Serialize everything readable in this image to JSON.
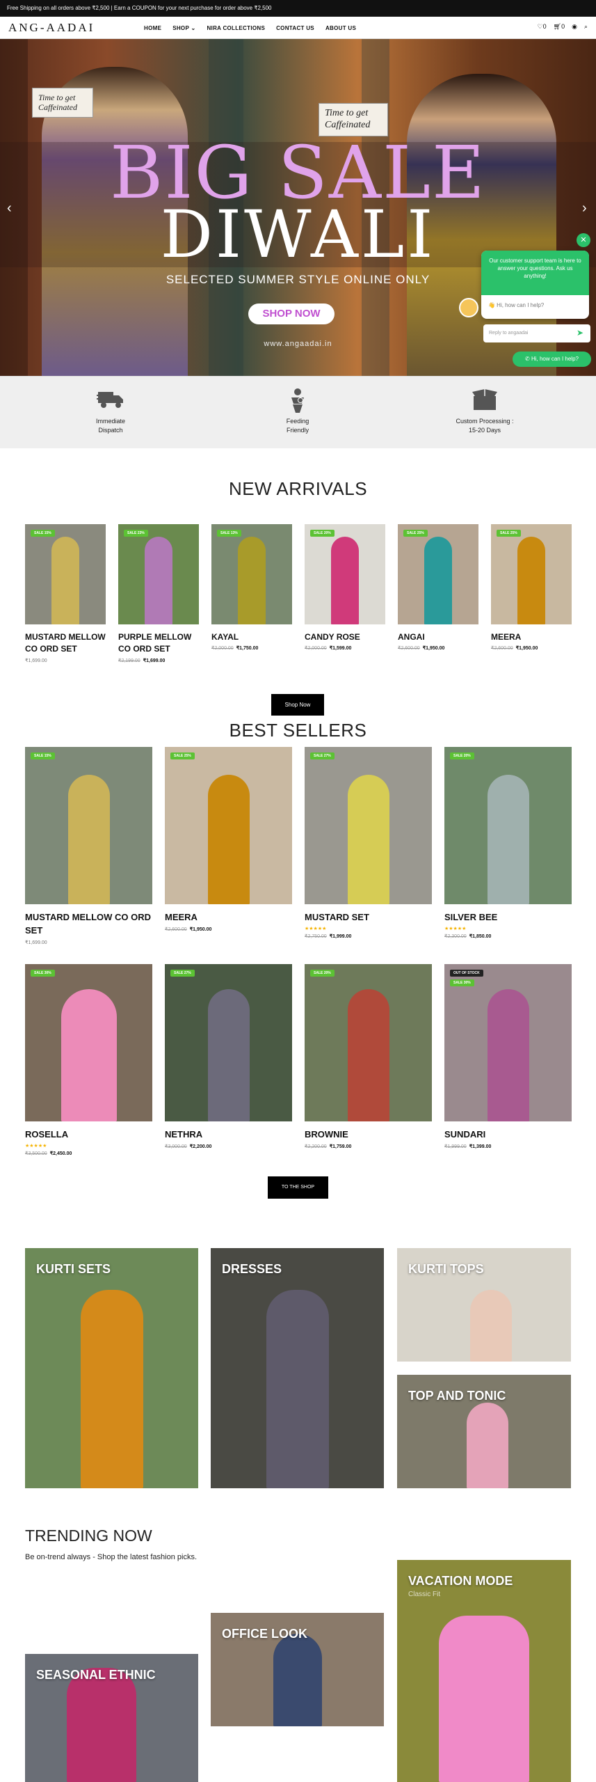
{
  "topbar": {
    "text": "Free Shipping on all orders above ₹2,500 | Earn a COUPON for your next purchase for order above ₹2,500"
  },
  "header": {
    "logo": "ANG-AADAI",
    "nav": [
      "HOME",
      "SHOP ⌄",
      "NIRA COLLECTIONS",
      "CONTACT US",
      "ABOUT US"
    ],
    "wishlist_count": "0",
    "cart_count": "0"
  },
  "hero": {
    "sign_left": "Time to get Caffeinated",
    "sign_right": "Time to get Caffeinated",
    "line1": "BIG SALE",
    "line2": "DIWALI",
    "subtitle": "SELECTED SUMMER STYLE ONLINE ONLY",
    "cta": "SHOP NOW",
    "site": "www.angaadai.in"
  },
  "chat": {
    "message": "Our customer support team is here to answer your questions. Ask us anything!",
    "quick": "👋 Hi, how can I help?",
    "placeholder": "Reply to angaadai",
    "button": "Hi, how can I help?"
  },
  "features": [
    {
      "line1": "Immediate",
      "line2": "Dispatch",
      "icon": "truck-icon"
    },
    {
      "line1": "Feeding",
      "line2": "Friendly",
      "icon": "mother-baby-icon"
    },
    {
      "line1": "Custom Processing :",
      "line2": "15-20 Days",
      "icon": "box-icon"
    }
  ],
  "new_arrivals": {
    "title": "NEW ARRIVALS",
    "button": "Shop Now",
    "items": [
      {
        "name": "MUSTARD MELLOW CO ORD SET",
        "old": "",
        "price": "₹1,699.00",
        "badge": "SALE 15%",
        "tone": "#c9b25a"
      },
      {
        "name": "PURPLE MELLOW CO ORD SET",
        "old": "₹2,199.00",
        "price": "₹1,699.00",
        "badge": "SALE 23%",
        "tone": "#b07ab5"
      },
      {
        "name": "KAYAL",
        "old": "₹2,000.00",
        "price": "₹1,750.00",
        "badge": "SALE 13%",
        "tone": "#a89b2a"
      },
      {
        "name": "CANDY ROSE",
        "old": "₹2,000.00",
        "price": "₹1,599.00",
        "badge": "SALE 20%",
        "tone": "#d03a7a"
      },
      {
        "name": "ANGAI",
        "old": "₹2,600.00",
        "price": "₹1,950.00",
        "badge": "SALE 25%",
        "tone": "#2a9a9a"
      },
      {
        "name": "MEERA",
        "old": "₹2,600.00",
        "price": "₹1,950.00",
        "badge": "SALE 25%",
        "tone": "#c88a10"
      }
    ]
  },
  "best_sellers": {
    "title": "BEST SELLERS",
    "button": "TO THE SHOP",
    "items": [
      {
        "name": "MUSTARD MELLOW CO ORD SET",
        "old": "",
        "price": "₹1,699.00",
        "badge": "SALE 15%",
        "stars": "",
        "tone": "#c9b25a"
      },
      {
        "name": "MEERA",
        "old": "₹2,600.00",
        "price": "₹1,950.00",
        "badge": "SALE 25%",
        "stars": "",
        "tone": "#c88a10"
      },
      {
        "name": "MUSTARD SET",
        "old": "₹2,750.00",
        "price": "₹1,999.00",
        "badge": "SALE 27%",
        "stars": "★★★★★",
        "tone": "#d6cc55"
      },
      {
        "name": "SILVER BEE",
        "old": "₹2,300.00",
        "price": "₹1,850.00",
        "badge": "SALE 20%",
        "stars": "★★★★★",
        "tone": "#9fb0ad"
      },
      {
        "name": "ROSELLA",
        "old": "₹3,500.00",
        "price": "₹2,450.00",
        "badge": "SALE 30%",
        "stars": "★★★★★",
        "tone": "#ec8bb8"
      },
      {
        "name": "NETHRA",
        "old": "₹3,000.00",
        "price": "₹2,200.00",
        "badge": "SALE 27%",
        "stars": "",
        "tone": "#6c6a7a"
      },
      {
        "name": "BROWNIE",
        "old": "₹2,200.00",
        "price": "₹1,759.00",
        "badge": "SALE 20%",
        "stars": "",
        "tone": "#b04a3a"
      },
      {
        "name": "SUNDARI",
        "old": "₹1,999.00",
        "price": "₹1,399.00",
        "badge": "SALE 30%",
        "badge_top": "OUT OF STOCK",
        "stars": "",
        "tone": "#a85a90"
      }
    ]
  },
  "categories": [
    {
      "label": "KURTI SETS",
      "tone": "#d48a1a"
    },
    {
      "label": "DRESSES",
      "tone": "#5e5a6a"
    },
    {
      "label": "KURTI TOPS",
      "tone": "#e8c9b8"
    },
    {
      "label": "TOP AND TONIC",
      "tone": "#e4a3b8"
    }
  ],
  "trending": {
    "title": "TRENDING NOW",
    "subtitle": "Be on-trend always - Shop the latest fashion picks.",
    "items": [
      {
        "label": "SEASONAL ETHNIC",
        "tone": "#b8306a"
      },
      {
        "label": "OFFICE LOOK",
        "tone": "#3a4a6e"
      },
      {
        "label": "VACATION MODE",
        "sub": "Classic Fit",
        "tone": "#f08ac8"
      }
    ]
  }
}
